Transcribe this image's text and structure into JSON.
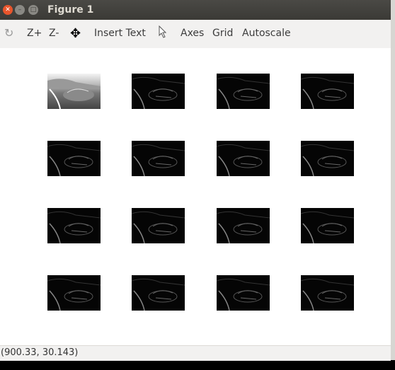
{
  "window": {
    "title": "Figure 1"
  },
  "toolbar": {
    "items": [
      {
        "icon": "rotate-icon",
        "label": ""
      },
      {
        "label": "Z+"
      },
      {
        "label": "Z-"
      },
      {
        "icon": "pan-icon",
        "label": ""
      },
      {
        "label": "Insert Text"
      },
      {
        "icon": "pointer-icon",
        "label": ""
      },
      {
        "label": "Axes"
      },
      {
        "label": "Grid"
      },
      {
        "label": "Autoscale"
      }
    ]
  },
  "figure": {
    "subplots": {
      "rows": 4,
      "cols": 4,
      "first_image": "grayscale car photo",
      "others": "edge-filtered car images"
    }
  },
  "status": {
    "coordinates": "(900.33, 30.143)"
  },
  "colors": {
    "titlebar": "#3c3b37",
    "close_button": "#e9552c",
    "canvas": "#ffffff"
  }
}
